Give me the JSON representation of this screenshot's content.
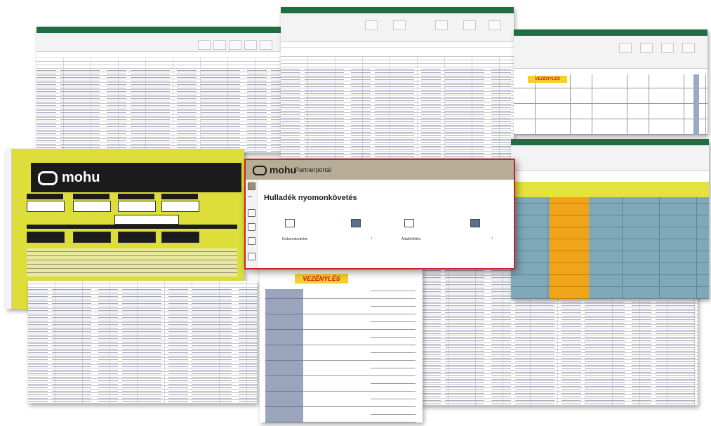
{
  "yellow_sheet": {
    "brand": "mohu"
  },
  "modal": {
    "brand": "mohu",
    "portal_label": "Partnerportál",
    "title": "Hulladék nyomonkövetés",
    "items": [
      {
        "label": "Kiskereskedelmi",
        "icon": "document-icon"
      },
      {
        "label": "Adatfeltöltés",
        "icon": "upload-icon"
      }
    ]
  },
  "vez_form": {
    "title": "VEZÉNYLÉS"
  },
  "orange_sheet": {
    "title": "VEZÉNYLÉS"
  },
  "colors": {
    "excel_green": "#1f6e43",
    "mohu_yellow": "#dede3a",
    "modal_border": "#d02020",
    "orange": "#f0a41a",
    "vez_red": "#d01818"
  }
}
